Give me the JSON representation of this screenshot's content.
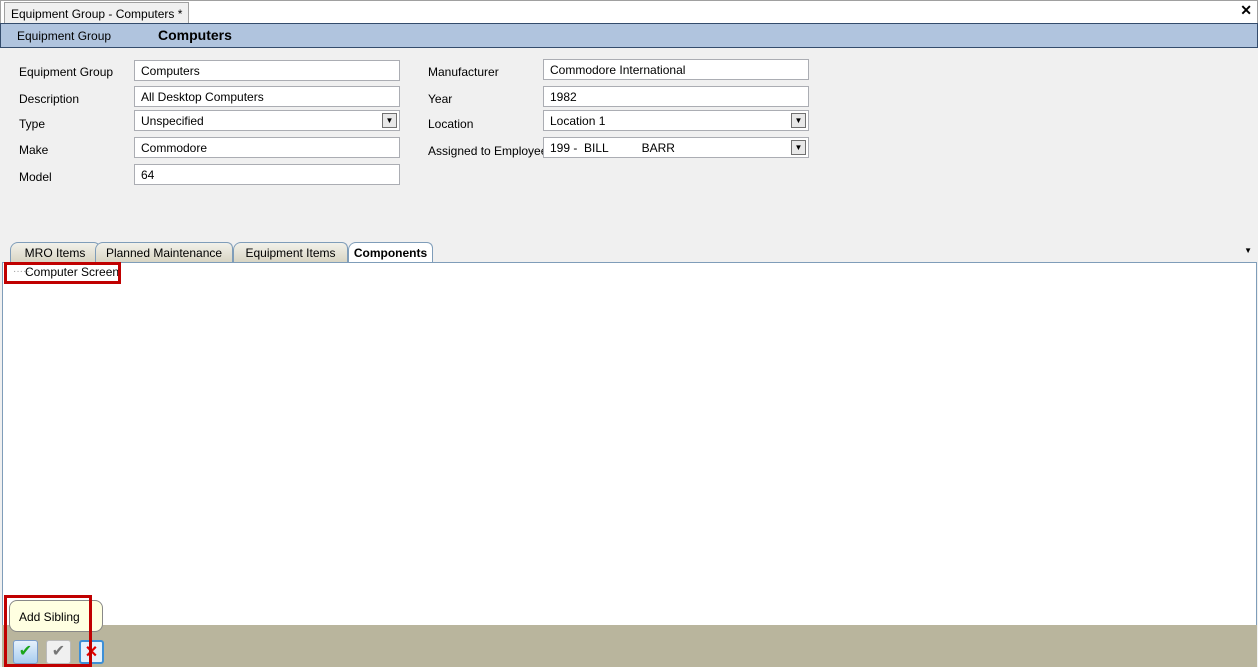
{
  "window": {
    "tab_title": "Equipment Group - Computers *"
  },
  "header": {
    "label": "Equipment Group",
    "value": "Computers"
  },
  "form": {
    "equipment_group": {
      "label": "Equipment Group",
      "value": "Computers"
    },
    "description": {
      "label": "Description",
      "value": "All Desktop Computers"
    },
    "type": {
      "label": "Type",
      "value": "Unspecified"
    },
    "make": {
      "label": "Make",
      "value": "Commodore"
    },
    "model": {
      "label": "Model",
      "value": "64"
    },
    "manufacturer": {
      "label": "Manufacturer",
      "value": "Commodore International"
    },
    "year": {
      "label": "Year",
      "value": "1982"
    },
    "location": {
      "label": "Location",
      "value": "Location 1"
    },
    "assigned": {
      "label": "Assigned to Employee",
      "value": "199 -  BILL          BARR"
    }
  },
  "tabs": [
    {
      "label": "MRO Items"
    },
    {
      "label": "Planned Maintenance"
    },
    {
      "label": "Equipment Items"
    },
    {
      "label": "Components",
      "active": true
    }
  ],
  "tree": {
    "items": [
      "Computer Screen"
    ]
  },
  "footer": {
    "tooltip": "Add Sibling"
  },
  "colors": {
    "header": "#b0c4de",
    "footer": "#b9b59d",
    "highlight": "#c00000"
  }
}
